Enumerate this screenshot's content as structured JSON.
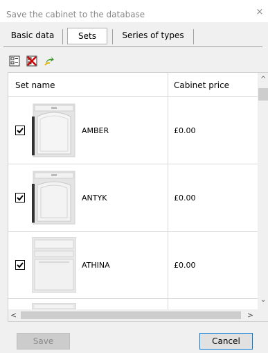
{
  "window": {
    "title": "Save the cabinet to the database",
    "close_glyph": "×"
  },
  "tabs": [
    {
      "label": "Basic data",
      "active": false
    },
    {
      "label": "Sets",
      "active": true
    },
    {
      "label": "Series of types",
      "active": false
    }
  ],
  "toolbar": {
    "icons": [
      "select-all-icon",
      "deselect-all-icon",
      "refresh-icon"
    ]
  },
  "table": {
    "columns": [
      "Set name",
      "Cabinet price"
    ],
    "rows": [
      {
        "checked": true,
        "name": "AMBER",
        "price": "£0.00"
      },
      {
        "checked": true,
        "name": "ANTYK",
        "price": "£0.00"
      },
      {
        "checked": true,
        "name": "ATHINA",
        "price": "£0.00"
      }
    ]
  },
  "buttons": {
    "save_label": "Save",
    "cancel_label": "Cancel"
  },
  "colors": {
    "accent": "#0078d7",
    "icon_red": "#cc0000",
    "icon_green": "#3c9a2a",
    "icon_yellow": "#e8b400"
  }
}
